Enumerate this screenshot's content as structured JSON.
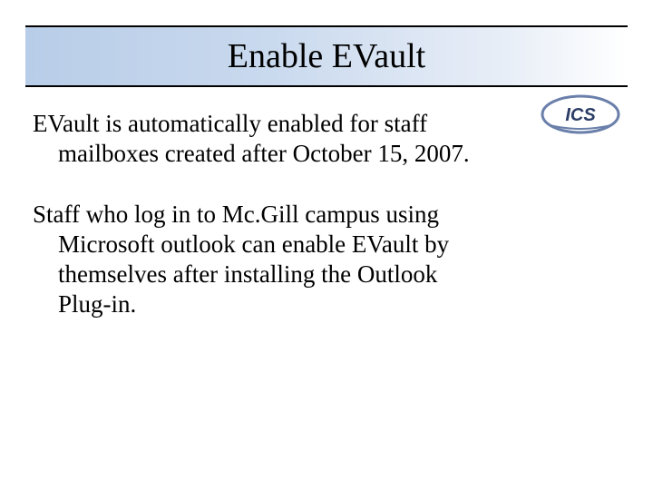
{
  "title": "Enable EVault",
  "logo_text": "ICS",
  "paragraphs": {
    "p1_line1": "EVault  is automatically enabled for staff",
    "p1_line2": "mailboxes created after October 15, 2007.",
    "p2_line1": "Staff  who log in to Mc.Gill campus using",
    "p2_line2": "Microsoft outlook can enable EVault by",
    "p2_line3": "themselves after installing the Outlook",
    "p2_line4": "Plug-in."
  }
}
